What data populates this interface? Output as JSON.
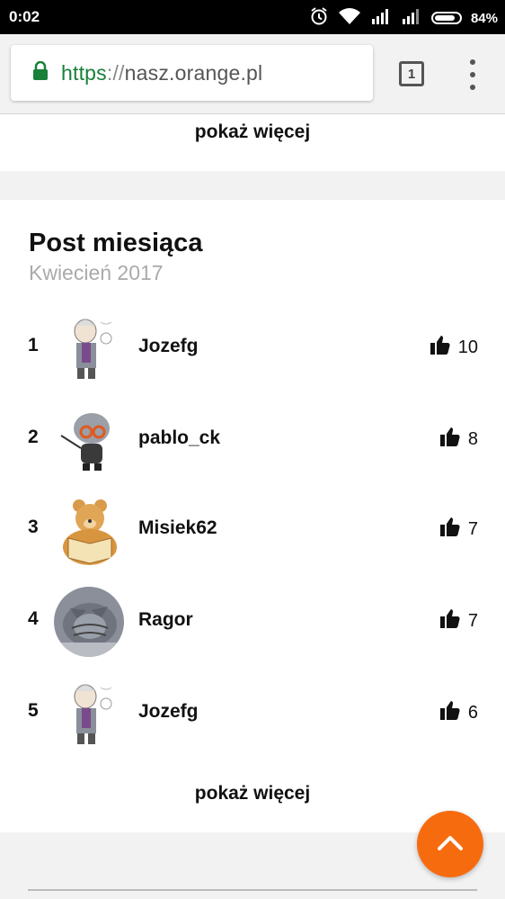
{
  "status_bar": {
    "time": "0:02",
    "battery": "84%",
    "battery_level": 0.84
  },
  "browser": {
    "url_scheme": "https",
    "url_separator": "://",
    "url_host": "nasz.orange.pl",
    "tab_count": "1"
  },
  "top_section": {
    "show_more": "pokaż więcej"
  },
  "post_of_month": {
    "title": "Post miesiąca",
    "period": "Kwiecień 2017",
    "entries": [
      {
        "rank": "1",
        "user": "Jozefg",
        "likes": "10",
        "avatar": "professor-avatar"
      },
      {
        "rank": "2",
        "user": "pablo_ck",
        "likes": "8",
        "avatar": "cartoon-teacher-avatar"
      },
      {
        "rank": "3",
        "user": "Misiek62",
        "likes": "7",
        "avatar": "teddy-bear-avatar"
      },
      {
        "rank": "4",
        "user": "Ragor",
        "likes": "7",
        "avatar": "cat-photo-avatar"
      },
      {
        "rank": "5",
        "user": "Jozefg",
        "likes": "6",
        "avatar": "professor-avatar"
      }
    ],
    "show_more": "pokaż więcej"
  },
  "colors": {
    "accent": "#f76b0f",
    "secure_green": "#188038"
  },
  "icons": {
    "like": "thumbs-up-icon",
    "scroll_top": "chevron-up-icon",
    "lock": "lock-icon",
    "menu": "more-vert-icon"
  }
}
